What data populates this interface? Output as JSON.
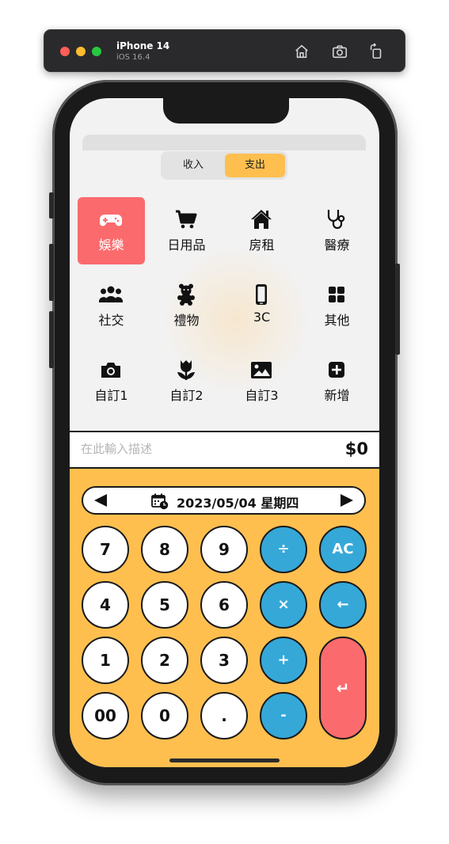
{
  "device": {
    "name": "iPhone 14",
    "os": "iOS 16.4"
  },
  "toolbar_icons": [
    "home-icon",
    "screenshot-icon",
    "rotate-icon"
  ],
  "segment": {
    "items": [
      "收入",
      "支出"
    ],
    "selected": "支出"
  },
  "categories": [
    {
      "label": "娛樂",
      "icon": "gamepad-icon",
      "selected": true
    },
    {
      "label": "日用品",
      "icon": "cart-icon",
      "selected": false
    },
    {
      "label": "房租",
      "icon": "house-icon",
      "selected": false
    },
    {
      "label": "醫療",
      "icon": "stethoscope-icon",
      "selected": false
    },
    {
      "label": "社交",
      "icon": "people-icon",
      "selected": false
    },
    {
      "label": "禮物",
      "icon": "teddy-bear-icon",
      "selected": false
    },
    {
      "label": "3C",
      "icon": "phone-icon",
      "selected": false
    },
    {
      "label": "其他",
      "icon": "grid-icon",
      "selected": false
    },
    {
      "label": "自訂1",
      "icon": "camera-icon",
      "selected": false
    },
    {
      "label": "自訂2",
      "icon": "tulip-icon",
      "selected": false
    },
    {
      "label": "自訂3",
      "icon": "image-icon",
      "selected": false
    },
    {
      "label": "新增",
      "icon": "plus-square-icon",
      "selected": false
    }
  ],
  "description": {
    "placeholder": "在此輸入描述",
    "value": ""
  },
  "amount": "$0",
  "date": {
    "text": "2023/05/04 星期四"
  },
  "keys": {
    "k7": "7",
    "k8": "8",
    "k9": "9",
    "divide": "÷",
    "ac": "AC",
    "k4": "4",
    "k5": "5",
    "k6": "6",
    "multiply": "×",
    "backspace": "←",
    "k1": "1",
    "k2": "2",
    "k3": "3",
    "plus": "+",
    "enter": "↵",
    "k00": "00",
    "k0": "0",
    "dot": ".",
    "minus": "-"
  },
  "colors": {
    "accent": "#ffbf4f",
    "selected": "#fb6b6d",
    "operator": "#35a8d8"
  }
}
